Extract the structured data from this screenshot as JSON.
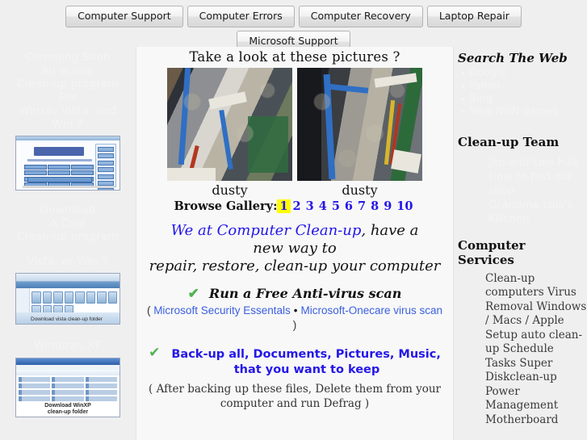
{
  "nav": {
    "row1": [
      {
        "label": "Computer Support"
      },
      {
        "label": "Computer Errors"
      },
      {
        "label": "Computer Recovery"
      },
      {
        "label": "Laptop Repair"
      }
    ],
    "row2": [
      {
        "label": "Microsoft Support"
      }
    ]
  },
  "left_sidebar": {
    "promo1": {
      "line1": "Comming Soon",
      "line2": "All in one",
      "line3": "Clean-up program",
      "line4": "For",
      "line5": "Winxp, Vista, and",
      "line6": "Win 7"
    },
    "thumb1_alt": "Computer Clean-Up application window",
    "promo2": {
      "line1": "Download",
      "line2": "A Cool",
      "line3": "Clean-up program",
      "line4": "Vista, or Win 7"
    },
    "thumb2_alt": "Windows Vista explorer folder",
    "thumb2_caption": "Download vista clean-up folder",
    "promo3": {
      "line1": "Windows XP"
    },
    "thumb3_alt": "Windows XP control panel folder",
    "thumb3_caption_line1": "Download WinXP",
    "thumb3_caption_line2": "clean-up folder"
  },
  "gallery": {
    "title": "Take a look at these pictures ?",
    "captions": [
      "dusty",
      "dusty"
    ],
    "browse_label": "Browse Gallery:",
    "pages": [
      "1",
      "2",
      "3",
      "4",
      "5",
      "6",
      "7",
      "8",
      "9",
      "10"
    ],
    "current_page": "1"
  },
  "main": {
    "headline_blue": "We at Computer Clean-up",
    "headline_rest": ", have a",
    "headline_line2": "new way to",
    "headline_line3": "repair, restore, clean-up your computer",
    "item1": {
      "check": "✔",
      "title": "Run a Free Anti-virus scan",
      "paren_open": "( ",
      "link1": "Microsoft Security Essentals",
      "bullet": "•",
      "link2": "Microsoft-Onecare virus scan",
      "paren_close": " )"
    },
    "item2": {
      "check": "✔",
      "title_line1": "Back-up all, Documents, Pictures, Music,",
      "title_line2": "that you want to keep",
      "note_line1": "( After backing up these files, Delete them from your",
      "note_line2": "computer and run Defrag )"
    }
  },
  "right_sidebar": {
    "search_heading": "Search The Web",
    "search_items": [
      {
        "label": "Google"
      },
      {
        "label": "Yahoo"
      },
      {
        "label": "Bing"
      },
      {
        "label": "New iWIN games"
      }
    ],
    "team_heading": "Clean-up Team",
    "team_items_line1": "Jim and Lois Fulk",
    "team_items_line2": "How to find our",
    "team_items_line3": "shop",
    "team_items_line4": "Grandma Lois's",
    "team_items_line5": "Kitchen",
    "services_heading_line1": "Computer",
    "services_heading_line2": "Services",
    "services": "Clean-up computers Virus Removal Windows / Macs / Apple Setup auto clean-up Schedule Tasks Super Diskclean-up Power Management Motherboard"
  },
  "colors": {
    "link_blue": "#2417e8",
    "highlight_yellow": "#ffff00",
    "check_green": "#4fb34f",
    "page_bg": "#efeff0",
    "panel_bg": "#f8f8f8",
    "ghost_text": "#f4f4f5"
  }
}
